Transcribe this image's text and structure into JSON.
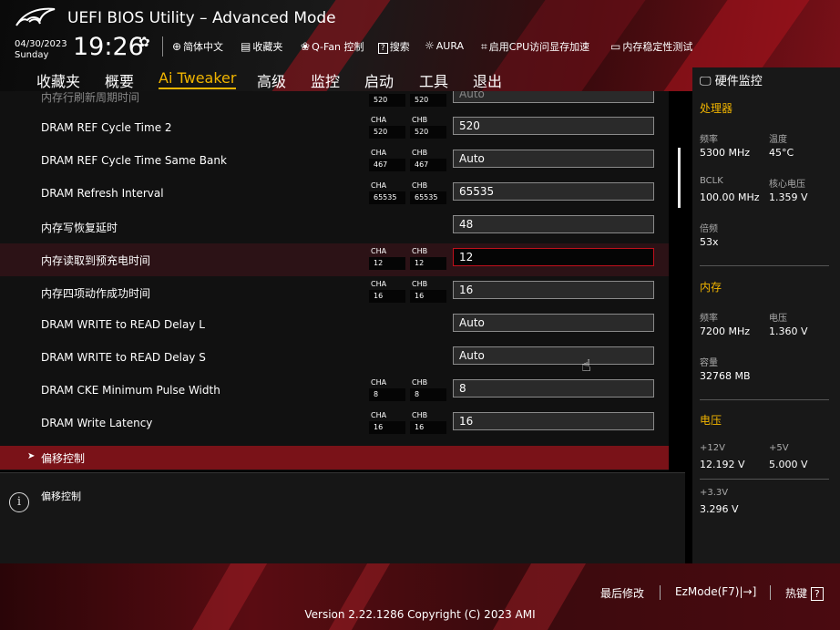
{
  "header": {
    "title": "UEFI BIOS Utility – Advanced Mode",
    "date": "04/30/2023",
    "day": "Sunday",
    "time": "19:26",
    "tools": [
      {
        "icon": "globe-icon",
        "label": "简体中文"
      },
      {
        "icon": "favorites-icon",
        "label": "收藏夹"
      },
      {
        "icon": "fan-icon",
        "label": "Q-Fan 控制"
      },
      {
        "icon": "help-box-icon",
        "label": "搜索"
      },
      {
        "icon": "aura-icon",
        "label": "AURA"
      },
      {
        "icon": "cpu-resize-icon",
        "label": "启用CPU访问显存加速"
      },
      {
        "icon": "memory-icon",
        "label": "内存稳定性测试"
      }
    ]
  },
  "menu": {
    "items": [
      "收藏夹",
      "概要",
      "Ai Tweaker",
      "高级",
      "监控",
      "启动",
      "工具",
      "退出"
    ],
    "active": "Ai Tweaker"
  },
  "settings": {
    "top_partial": {
      "label": "内存行刷新周期时间",
      "cha": "520",
      "chb": "520",
      "value": "Auto"
    },
    "rows": [
      {
        "label": "DRAM REF Cycle Time 2",
        "cha": "520",
        "chb": "520",
        "value": "520"
      },
      {
        "label": "DRAM REF Cycle Time Same Bank",
        "cha": "467",
        "chb": "467",
        "value": "Auto"
      },
      {
        "label": "DRAM Refresh Interval",
        "cha": "65535",
        "chb": "65535",
        "value": "65535"
      },
      {
        "label": "内存写恢复延时",
        "cha": null,
        "chb": null,
        "value": "48"
      },
      {
        "label": "内存读取到预充电时间",
        "cha": "12",
        "chb": "12",
        "value": "12"
      },
      {
        "label": "内存四项动作成功时间",
        "cha": "16",
        "chb": "16",
        "value": "16"
      },
      {
        "label": "DRAM WRITE to READ Delay L",
        "cha": null,
        "chb": null,
        "value": "Auto"
      },
      {
        "label": "DRAM WRITE to READ Delay S",
        "cha": null,
        "chb": null,
        "value": "Auto"
      },
      {
        "label": "DRAM CKE Minimum Pulse Width",
        "cha": "8",
        "chb": "8",
        "value": "8"
      },
      {
        "label": "DRAM Write Latency",
        "cha": "16",
        "chb": "16",
        "value": "16"
      }
    ],
    "channel_a": "CHA",
    "channel_b": "CHB",
    "highlighted_index": 4,
    "submenu": "偏移控制"
  },
  "help": {
    "text": "偏移控制"
  },
  "hardware_monitor": {
    "title": "硬件监控",
    "cpu": {
      "section": "处理器",
      "freq_label": "频率",
      "freq": "5300 MHz",
      "temp_label": "温度",
      "temp": "45°C",
      "bclk_label": "BCLK",
      "bclk": "100.00 MHz",
      "vcore_label": "核心电压",
      "vcore": "1.359 V",
      "ratio_label": "倍频",
      "ratio": "53x"
    },
    "memory": {
      "section": "内存",
      "freq_label": "频率",
      "freq": "7200 MHz",
      "volt_label": "电压",
      "volt": "1.360 V",
      "cap_label": "容量",
      "cap": "32768 MB"
    },
    "voltage": {
      "section": "电压",
      "v12_label": "+12V",
      "v12": "12.192 V",
      "v5_label": "+5V",
      "v5": "5.000 V",
      "v33_label": "+3.3V",
      "v33": "3.296 V"
    }
  },
  "footer": {
    "last_modified": "最后修改",
    "ezmode": "EzMode(F7)|",
    "hotkeys": "热键",
    "hotkey_glyph": "?",
    "version": "Version 2.22.1286 Copyright (C) 2023 AMI"
  },
  "colors": {
    "accent": "#f0b400",
    "highlight_border": "#c0101c",
    "submenu_bg": "#7a1218"
  }
}
